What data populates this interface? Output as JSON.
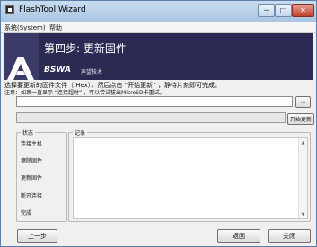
{
  "window": {
    "title": "FlashTool Wizard",
    "minimize_glyph": "─",
    "maximize_glyph": "□",
    "close_glyph": "✕"
  },
  "menu": {
    "items": [
      {
        "label": "系统(System)"
      },
      {
        "label": "帮助"
      }
    ]
  },
  "banner": {
    "step_title": "第四步: 更新固件",
    "brand": "BSWA",
    "brand_cn": "声望技术",
    "background_color": "#2a2a52"
  },
  "instruction": "选择要更新的固件文件（.Hex），然后点击 “开始更新” ，静待片刻即可完成。",
  "note": "注意：如果一直显示 “连接超时” ，可以尝试拔出MicroSD卡重试。",
  "file_input": {
    "value": "",
    "browse_label": "..."
  },
  "progress": {
    "fraction": 0.0,
    "start_label": "开始更新"
  },
  "status_panel": {
    "legend": "状态",
    "items": [
      {
        "label": "连接主机"
      },
      {
        "label": "擦除固件"
      },
      {
        "label": "更新固件"
      },
      {
        "label": "断开连接"
      },
      {
        "label": "完成"
      }
    ]
  },
  "log_panel": {
    "legend": "记录",
    "scroll_up_glyph": "▲",
    "scroll_down_glyph": "▼"
  },
  "nav": {
    "prev_label": "上一步",
    "back_label": "返回",
    "close_label": "关闭"
  }
}
